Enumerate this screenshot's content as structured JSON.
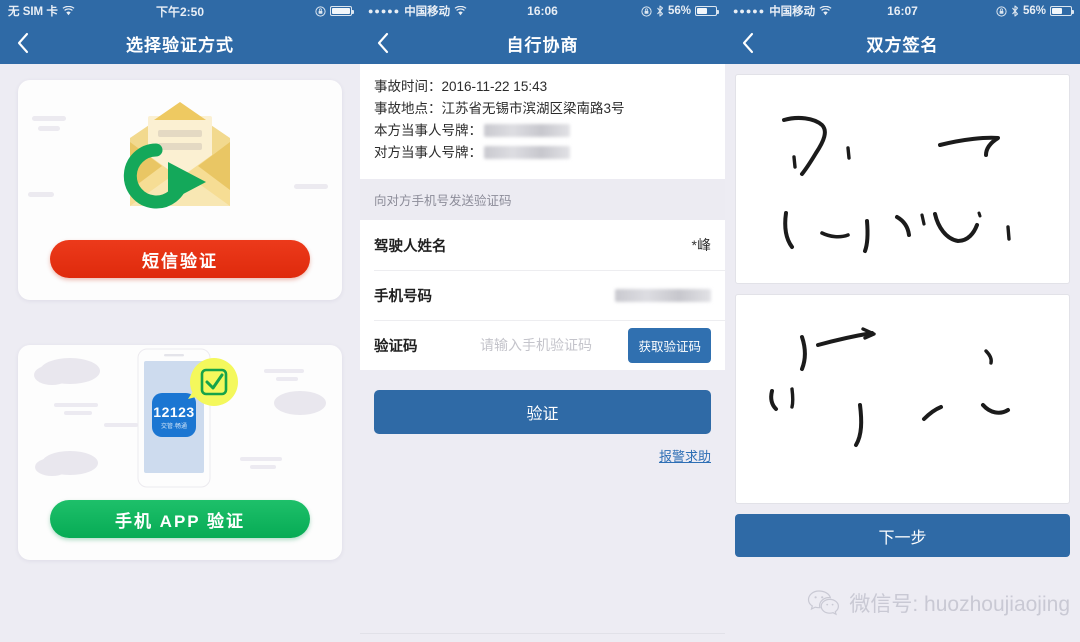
{
  "panels": [
    {
      "statusbar": {
        "carrier": "无 SIM 卡",
        "time": "下午2:50",
        "battery_pct": ""
      },
      "nav": {
        "back_icon": "chevron-left-icon",
        "title": "选择验证方式"
      },
      "cards": [
        {
          "art": "envelope-arrow-icon",
          "button_label": "短信验证",
          "button_color": "#e33216"
        },
        {
          "art": "phone-app-check-icon",
          "app_logo_text": "12123",
          "app_logo_sub": "交管·畅通",
          "button_label": "手机 APP 验证",
          "button_color": "#12b45f"
        }
      ]
    },
    {
      "statusbar": {
        "carrier": "中国移动",
        "time": "16:06",
        "battery_pct": "56%"
      },
      "nav": {
        "back_icon": "chevron-left-icon",
        "title": "自行协商"
      },
      "info": [
        {
          "label": "事故时间：",
          "value": "2016-11-22 15:43",
          "redacted": false
        },
        {
          "label": "事故地点：",
          "value": "江苏省无锡市滨湖区梁南路3号",
          "redacted": false
        },
        {
          "label": "本方当事人号牌：",
          "value": "",
          "redacted": true,
          "redact_width": 86
        },
        {
          "label": "对方当事人号牌：",
          "value": "",
          "redacted": true,
          "redact_width": 86
        }
      ],
      "section_title": "向对方手机号发送验证码",
      "fields": [
        {
          "label": "驾驶人姓名",
          "value": "*峰",
          "placeholder": "",
          "redacted": false
        },
        {
          "label": "手机号码",
          "value": "",
          "placeholder": "",
          "redacted": true,
          "redact_width": 96
        },
        {
          "label": "验证码",
          "value": "",
          "placeholder": "请输入手机验证码",
          "redacted": false,
          "action_label": "获取验证码"
        }
      ],
      "verify_label": "验证",
      "help_label": "报警求助"
    },
    {
      "statusbar": {
        "carrier": "中国移动",
        "time": "16:07",
        "battery_pct": "56%"
      },
      "nav": {
        "back_icon": "chevron-left-icon",
        "title": "双方签名"
      },
      "signature_boxes": [
        "signature-canvas-party-a",
        "signature-canvas-party-b"
      ],
      "next_label": "下一步"
    }
  ],
  "watermark": {
    "icon": "wechat-icon",
    "text": "微信号: huozhoujiaojing"
  },
  "colors": {
    "header_blue": "#2f6aa6",
    "accent_red": "#e33216",
    "accent_green": "#12b45f",
    "page_bg": "#edecf3"
  }
}
